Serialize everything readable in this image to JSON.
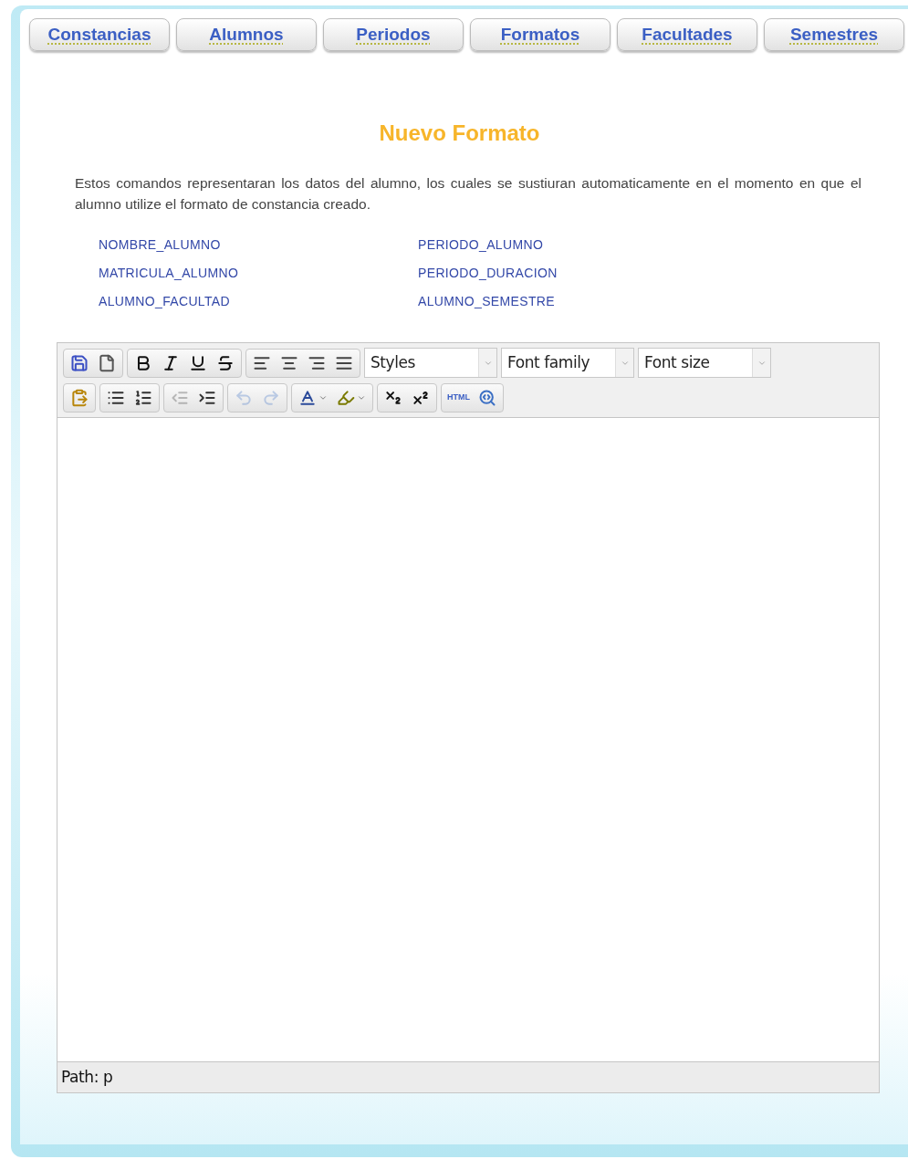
{
  "tabs": [
    {
      "label": "Constancias",
      "selected": false
    },
    {
      "label": "Alumnos",
      "selected": false
    },
    {
      "label": "Periodos",
      "selected": false
    },
    {
      "label": "Formatos",
      "selected": false
    },
    {
      "label": "Facultades",
      "selected": false
    },
    {
      "label": "Semestres",
      "selected": false
    }
  ],
  "title": "Nuevo Formato",
  "description": "Estos comandos representaran los datos del alumno, los cuales se sustiuran automaticamente en el momento en que el alumno utilize el formato de constancia creado.",
  "commands": [
    "NOMBRE_ALUMNO",
    "PERIODO_ALUMNO",
    "MATRICULA_ALUMNO",
    "PERIODO_DURACION",
    "ALUMNO_FACULTAD",
    "ALUMNO_SEMESTRE"
  ],
  "toolbar_rows": [
    [
      {
        "kind": "buttons",
        "buttons": [
          {
            "kind": "save",
            "disabled": false
          },
          {
            "kind": "new",
            "disabled": false
          }
        ]
      },
      {
        "kind": "buttons",
        "buttons": [
          {
            "kind": "bold",
            "disabled": false
          },
          {
            "kind": "italic",
            "disabled": false
          },
          {
            "kind": "underline",
            "disabled": false
          },
          {
            "kind": "strike",
            "disabled": false
          }
        ]
      },
      {
        "kind": "buttons",
        "buttons": [
          {
            "kind": "align-left",
            "disabled": false
          },
          {
            "kind": "align-center",
            "disabled": false
          },
          {
            "kind": "align-right",
            "disabled": false
          },
          {
            "kind": "justify",
            "disabled": false
          }
        ]
      },
      {
        "kind": "select",
        "placeholder": "Styles"
      },
      {
        "kind": "select",
        "placeholder": "Font family"
      },
      {
        "kind": "select",
        "placeholder": "Font size"
      }
    ],
    [
      {
        "kind": "buttons",
        "buttons": [
          {
            "kind": "paste-word",
            "disabled": false
          }
        ]
      },
      {
        "kind": "buttons",
        "buttons": [
          {
            "kind": "bullets",
            "disabled": false
          },
          {
            "kind": "numbers",
            "disabled": false
          }
        ]
      },
      {
        "kind": "buttons",
        "buttons": [
          {
            "kind": "outdent",
            "disabled": true
          },
          {
            "kind": "indent",
            "disabled": false
          }
        ]
      },
      {
        "kind": "buttons",
        "buttons": [
          {
            "kind": "undo",
            "disabled": true
          },
          {
            "kind": "redo",
            "disabled": true
          }
        ]
      },
      {
        "kind": "buttons",
        "buttons": [
          {
            "kind": "text-color",
            "disabled": false
          },
          {
            "kind": "highlight",
            "disabled": false
          }
        ]
      },
      {
        "kind": "buttons",
        "buttons": [
          {
            "kind": "subscript",
            "disabled": false
          },
          {
            "kind": "superscript",
            "disabled": false
          }
        ]
      },
      {
        "kind": "buttons",
        "buttons": [
          {
            "kind": "html",
            "label": "HTML",
            "disabled": false
          },
          {
            "kind": "preview",
            "disabled": false
          }
        ]
      }
    ]
  ],
  "path": "Path: p"
}
